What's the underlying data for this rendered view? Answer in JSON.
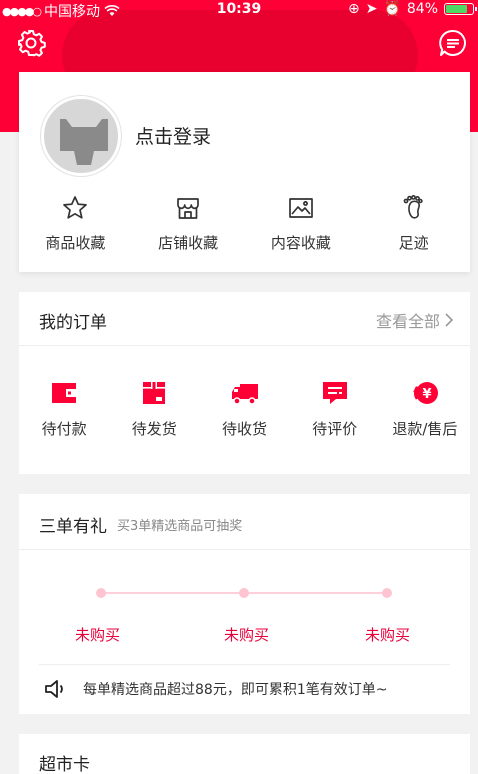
{
  "status_bar": {
    "carrier": "中国移动",
    "time": "10:39",
    "battery_percent": "84%",
    "battery_level": 0.84
  },
  "profile": {
    "login_text": "点击登录"
  },
  "favorites": [
    {
      "label": "商品收藏",
      "icon": "star-icon"
    },
    {
      "label": "店铺收藏",
      "icon": "shop-icon"
    },
    {
      "label": "内容收藏",
      "icon": "image-icon"
    },
    {
      "label": "足迹",
      "icon": "footprint-icon"
    }
  ],
  "orders": {
    "title": "我的订单",
    "see_all": "查看全部",
    "items": [
      {
        "label": "待付款",
        "icon": "wallet-icon"
      },
      {
        "label": "待发货",
        "icon": "box-icon"
      },
      {
        "label": "待收货",
        "icon": "truck-icon"
      },
      {
        "label": "待评价",
        "icon": "comment-icon"
      },
      {
        "label": "退款/售后",
        "icon": "refund-icon"
      }
    ]
  },
  "promo": {
    "title": "三单有礼",
    "subtitle": "买3单精选商品可抽奖",
    "steps": [
      "未购买",
      "未购买",
      "未购买"
    ],
    "notice": "每单精选商品超过88元，即可累积1笔有效订单~"
  },
  "supermarket": {
    "title": "超市卡"
  },
  "colors": {
    "brand_red": "#ff0036",
    "step_red": "#e8003a"
  }
}
